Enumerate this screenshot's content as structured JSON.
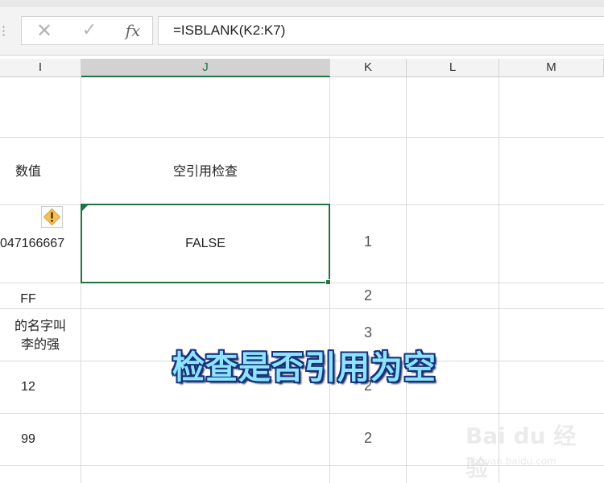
{
  "formula_bar": {
    "cancel_icon": "✕",
    "enter_icon": "✓",
    "function_icon": "fx",
    "formula": "=ISBLANK(K2:K7)"
  },
  "column_headers": [
    "I",
    "J",
    "K",
    "L",
    "M"
  ],
  "selected_column": "J",
  "cells": {
    "i_header": "数值",
    "j_header": "空引用检查",
    "i_row3": "047166667",
    "j_row3": "FALSE",
    "k_row3": "1",
    "i_row4": "FF",
    "k_row4": "2",
    "i_row5": "的名字叫\n李的强",
    "k_row5": "3",
    "i_row6": "12",
    "k_row6": "2",
    "i_row7": "99",
    "k_row7": "2"
  },
  "warning_icon": "warning-diamond-icon",
  "caption": "检查是否引用为空",
  "watermark": {
    "logo": "Bai du 经验",
    "url": "jingyan.baidu.com"
  },
  "colors": {
    "accent": "#217346",
    "caption_fill": "#8ee4ff",
    "caption_outline": "#16327a"
  }
}
